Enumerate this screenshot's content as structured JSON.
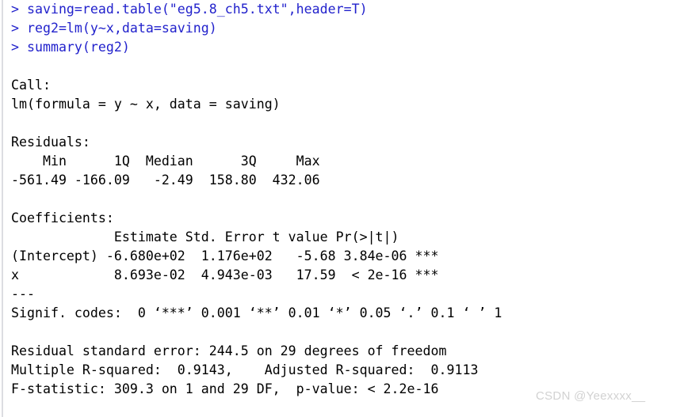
{
  "console": {
    "prompt_color": "#2222cc",
    "text_color": "#000000",
    "background_color": "#ffffff",
    "gutter_color": "#dcdde2",
    "lines": [
      {
        "kind": "prompt",
        "text": "> saving=read.table(\"eg5.8_ch5.txt\",header=T)"
      },
      {
        "kind": "prompt",
        "text": "> reg2=lm(y~x,data=saving)"
      },
      {
        "kind": "prompt",
        "text": "> summary(reg2)"
      },
      {
        "kind": "blank",
        "text": ""
      },
      {
        "kind": "output",
        "text": "Call:"
      },
      {
        "kind": "output",
        "text": "lm(formula = y ~ x, data = saving)"
      },
      {
        "kind": "blank",
        "text": ""
      },
      {
        "kind": "output",
        "text": "Residuals:"
      },
      {
        "kind": "output",
        "text": "    Min      1Q  Median      3Q     Max"
      },
      {
        "kind": "output",
        "text": "-561.49 -166.09   -2.49  158.80  432.06"
      },
      {
        "kind": "blank",
        "text": ""
      },
      {
        "kind": "output",
        "text": "Coefficients:"
      },
      {
        "kind": "output",
        "text": "             Estimate Std. Error t value Pr(>|t|)"
      },
      {
        "kind": "output",
        "text": "(Intercept) -6.680e+02  1.176e+02   -5.68 3.84e-06 ***"
      },
      {
        "kind": "output",
        "text": "x            8.693e-02  4.943e-03   17.59  < 2e-16 ***"
      },
      {
        "kind": "output",
        "text": "---"
      },
      {
        "kind": "output",
        "text": "Signif. codes:  0 ‘***’ 0.001 ‘**’ 0.01 ‘*’ 0.05 ‘.’ 0.1 ‘ ’ 1"
      },
      {
        "kind": "blank",
        "text": ""
      },
      {
        "kind": "output",
        "text": "Residual standard error: 244.5 on 29 degrees of freedom"
      },
      {
        "kind": "output",
        "text": "Multiple R-squared:  0.9143,\tAdjusted R-squared:  0.9113"
      },
      {
        "kind": "output",
        "text": "F-statistic: 309.3 on 1 and 29 DF,  p-value: < 2.2e-16"
      }
    ]
  },
  "watermark": {
    "text": "CSDN @Yeexxxx__",
    "color": "#d2d2d2"
  }
}
